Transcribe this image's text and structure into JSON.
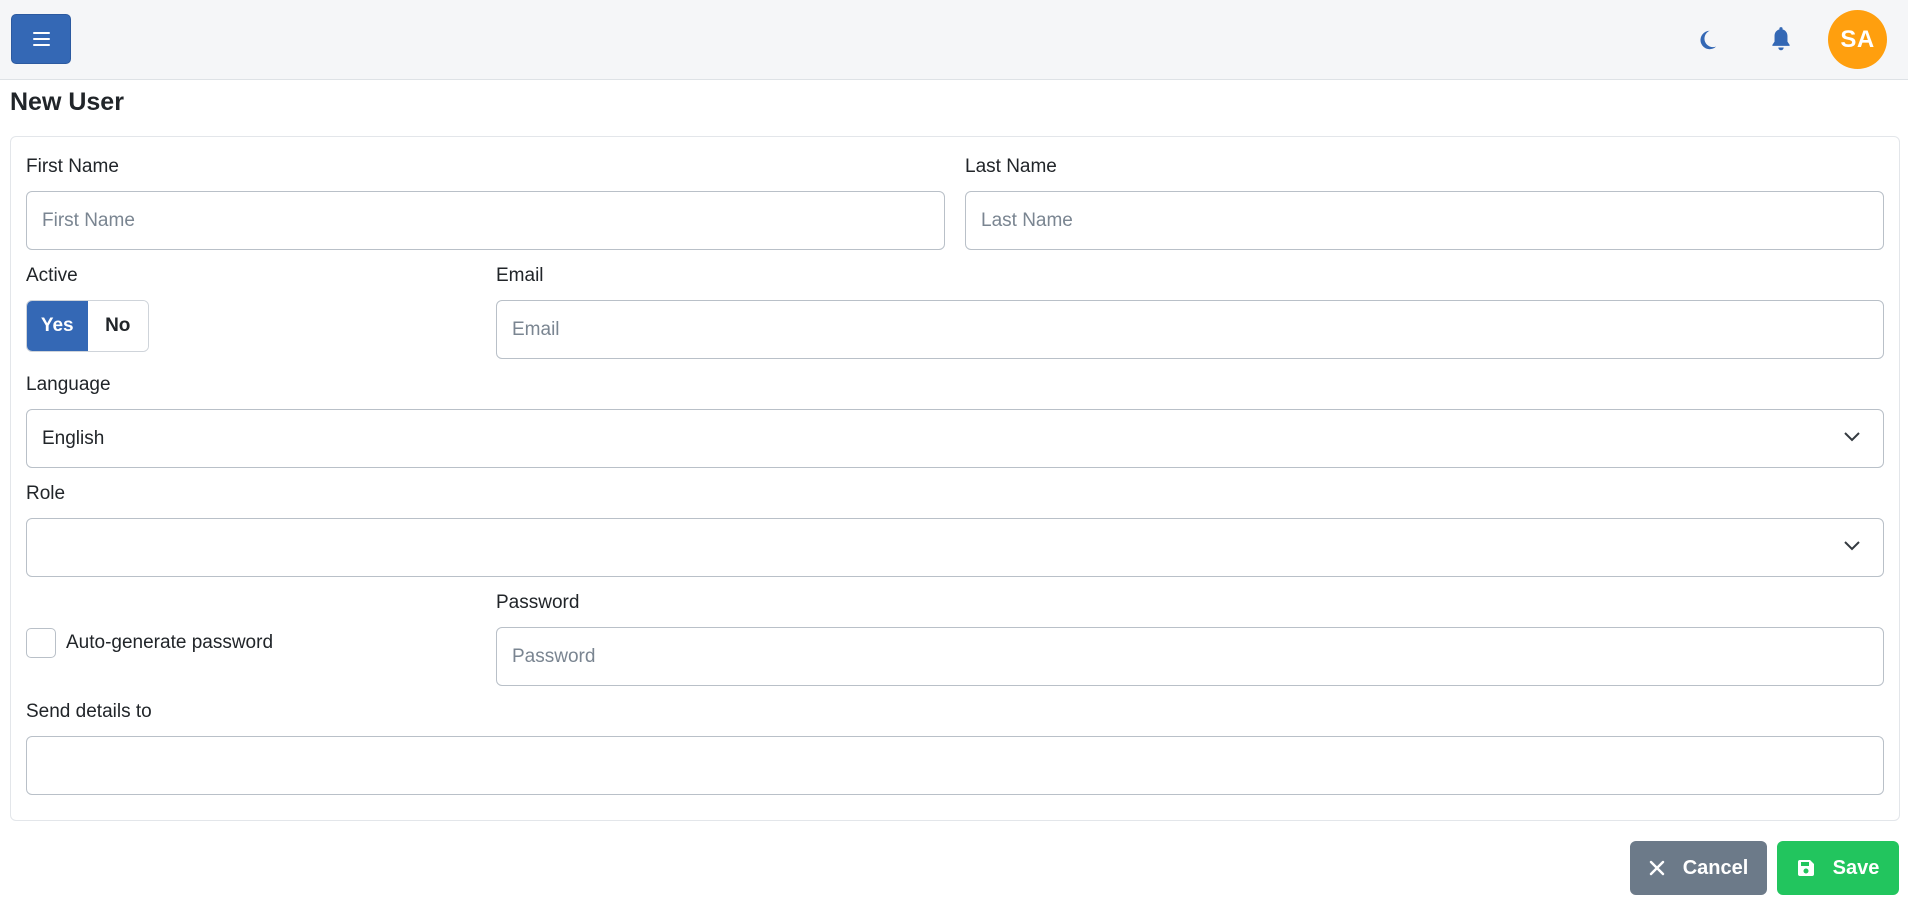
{
  "header": {
    "menu_icon": "hamburger-icon",
    "theme_icon": "moon-icon",
    "notification_icon": "bell-icon",
    "avatar_initials": "SA",
    "colors": {
      "primary": "#3468b5",
      "avatar": "#ff9f0e",
      "save": "#22c55e",
      "cancel": "#6c7a89"
    }
  },
  "page": {
    "title": "New User"
  },
  "form": {
    "first_name": {
      "label": "First Name",
      "placeholder": "First Name",
      "value": ""
    },
    "last_name": {
      "label": "Last Name",
      "placeholder": "Last Name",
      "value": ""
    },
    "active": {
      "label": "Active",
      "yes": "Yes",
      "no": "No",
      "selected": "Yes"
    },
    "email": {
      "label": "Email",
      "placeholder": "Email",
      "value": ""
    },
    "language": {
      "label": "Language",
      "value": "English"
    },
    "role": {
      "label": "Role",
      "value": ""
    },
    "auto_password": {
      "label": "Auto-generate password",
      "checked": false
    },
    "password": {
      "label": "Password",
      "placeholder": "Password",
      "value": ""
    },
    "send_details": {
      "label": "Send details to",
      "value": ""
    }
  },
  "actions": {
    "cancel_label": "Cancel",
    "cancel_icon": "close-icon",
    "save_label": "Save",
    "save_icon": "floppy-disk-icon"
  }
}
